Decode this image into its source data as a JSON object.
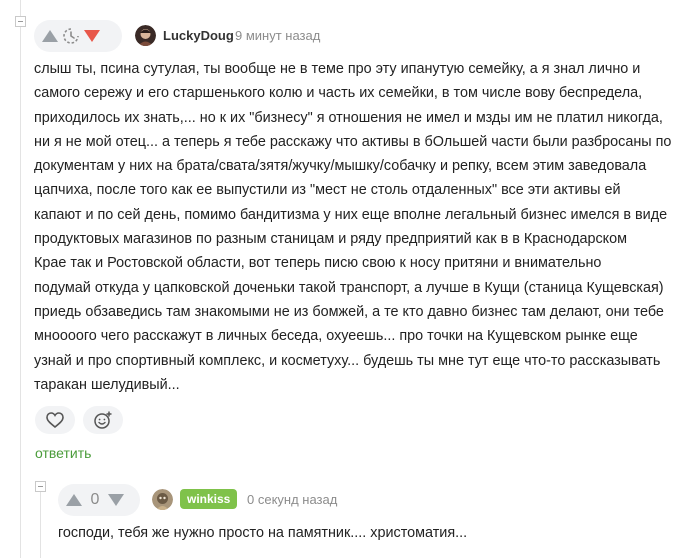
{
  "comments": [
    {
      "username": "LuckyDoug",
      "time": "9 минут назад",
      "lines": [
        "слыш ты, псина сутулая, ты вообще не в теме про эту ипанутую семейку, а я знал лично и",
        "самого сережу и его старшенького колю и часть их семейки, в том числе вову беспредела,",
        "приходилось их знать,... но к их \"бизнесу\" я отношения не имел и мзды им не платил никогда,",
        "ни я не мой отец... а теперь я тебе расскажу что активы в бОльшей части были разбросаны по",
        "документам у них на брата/свата/зятя/жучку/мышку/собачку и репку, всем этим заведовала",
        "цапчиха, после того как ее выпустили из \"мест не столь отдаленных\" все эти активы ей",
        "капают и по сей день, помимо бандитизма у них еще вполне легальный бизнес имелся в виде",
        "продуктовых магазинов по разным станицам и ряду предприятий как в в Краснодарском",
        "Крае так и Ростовской области, вот теперь писю свою к носу притяни и внимательно",
        "подумай откуда у цапковской доченьки такой транспорт, а лучше в Кущи (станица Кущевская)",
        "приедь обзаведись там знакомыми не из бомжей, а те кто давно бизнес там делают, они тебе",
        "мноооого чего расскажут в личных беседа, охуеешь... про точки на Кущевском рынке еще",
        "узнай и про спортивный комплекс, и косметуху... будешь ты мне тут еще что-то рассказывать",
        "таракан шелудивый..."
      ],
      "reply_label": "ответить"
    },
    {
      "score": "0",
      "username": "winkiss",
      "time": "0 секунд назад",
      "lines": [
        "господи, тебя же нужно просто на памятник.... христоматия..."
      ]
    }
  ],
  "colors": {
    "downvote_active": "#e8574a",
    "author_badge": "#7fc24a",
    "reply_link": "#4a9c3a"
  }
}
